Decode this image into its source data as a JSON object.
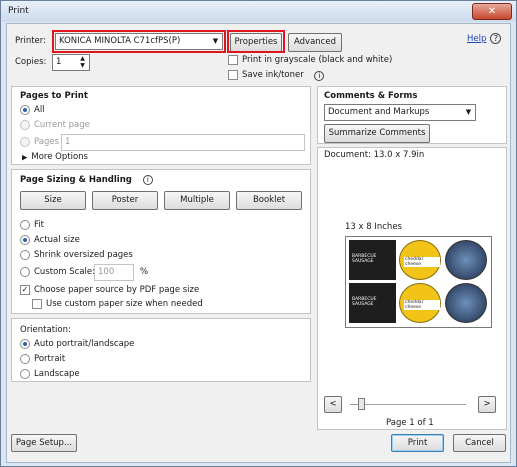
{
  "window": {
    "title": "Print",
    "close_glyph": "✕"
  },
  "printer": {
    "label": "Printer:",
    "value": "KONICA MINOLTA C71cfPS(P)",
    "properties_label": "Properties",
    "advanced_label": "Advanced",
    "help_label": "Help"
  },
  "copies": {
    "label": "Copies:",
    "value": "1"
  },
  "options": {
    "grayscale_label": "Print in grayscale (black and white)",
    "save_ink_label": "Save ink/toner"
  },
  "pages_to_print": {
    "heading": "Pages to Print",
    "all_label": "All",
    "current_label": "Current page",
    "pages_label": "Pages",
    "pages_value": "1",
    "more_options_label": "More Options"
  },
  "sizing": {
    "heading": "Page Sizing & Handling",
    "tabs": [
      "Size",
      "Poster",
      "Multiple",
      "Booklet"
    ],
    "fit_label": "Fit",
    "actual_label": "Actual size",
    "shrink_label": "Shrink oversized pages",
    "custom_label": "Custom Scale:",
    "custom_value": "100",
    "custom_unit": "%",
    "choose_source_label": "Choose paper source by PDF page size",
    "custom_paper_label": "Use custom paper size when needed"
  },
  "orientation": {
    "heading": "Orientation:",
    "auto_label": "Auto portrait/landscape",
    "portrait_label": "Portrait",
    "landscape_label": "Landscape"
  },
  "comments": {
    "heading": "Comments & Forms",
    "value": "Document and Markups",
    "summarize_label": "Summarize Comments"
  },
  "preview": {
    "document_size": "Document: 13.0 x 7.9in",
    "paper_size": "13 x 8 Inches",
    "page_indicator": "Page 1 of 1",
    "prev_glyph": "<",
    "next_glyph": ">",
    "label_text_a": "BARBECUE SAUSAGE",
    "label_text_b": "cheddar cheese"
  },
  "footer": {
    "page_setup_label": "Page Setup...",
    "print_label": "Print",
    "cancel_label": "Cancel"
  },
  "colors": {
    "highlight": "#e0161e",
    "link": "#1a45b8",
    "label_yellow": "#f2c418",
    "label_dark": "#1e1e1e"
  }
}
